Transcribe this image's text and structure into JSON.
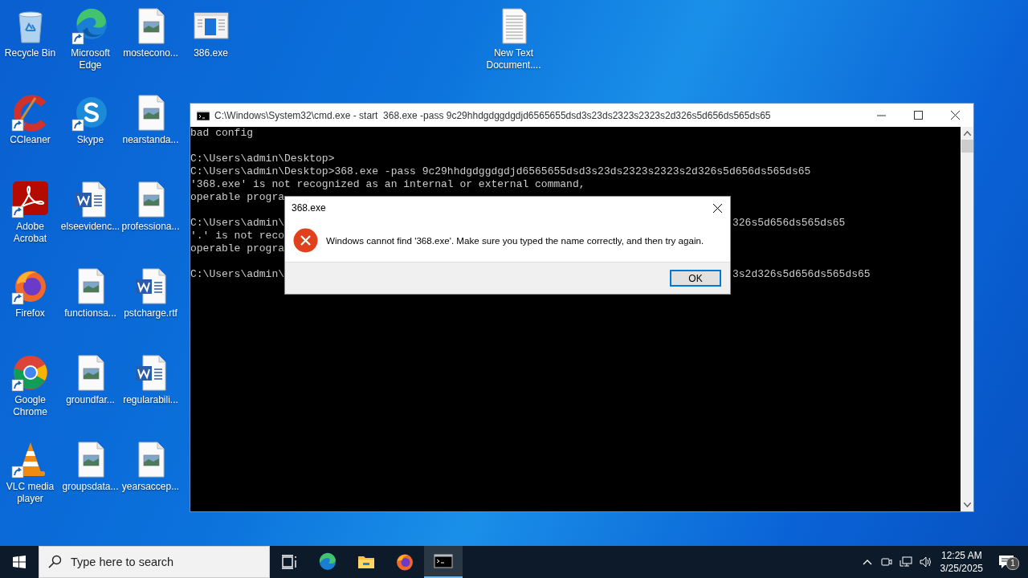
{
  "desktop_columns": [
    [
      {
        "label": "Recycle Bin",
        "kind": "recycle",
        "shortcut": false
      },
      {
        "label": "CCleaner",
        "kind": "ccleaner",
        "shortcut": true
      },
      {
        "label": "Adobe Acrobat",
        "kind": "acrobat",
        "shortcut": true
      },
      {
        "label": "Firefox",
        "kind": "firefox",
        "shortcut": true
      },
      {
        "label": "Google Chrome",
        "kind": "chrome",
        "shortcut": true
      },
      {
        "label": "VLC media player",
        "kind": "vlc",
        "shortcut": true
      }
    ],
    [
      {
        "label": "Microsoft Edge",
        "kind": "edge",
        "shortcut": true
      },
      {
        "label": "Skype",
        "kind": "skype",
        "shortcut": true
      },
      {
        "label": "elseevidenc...",
        "kind": "word",
        "shortcut": false
      },
      {
        "label": "functionsa...",
        "kind": "image",
        "shortcut": false
      },
      {
        "label": "groundfar...",
        "kind": "image",
        "shortcut": false
      },
      {
        "label": "groupsdata...",
        "kind": "image",
        "shortcut": false
      }
    ],
    [
      {
        "label": "mostecono...",
        "kind": "image",
        "shortcut": false
      },
      {
        "label": "nearstanda...",
        "kind": "image",
        "shortcut": false
      },
      {
        "label": "professiona...",
        "kind": "image",
        "shortcut": false
      },
      {
        "label": "pstcharge.rtf",
        "kind": "word",
        "shortcut": false
      },
      {
        "label": "regularabili...",
        "kind": "word",
        "shortcut": false
      },
      {
        "label": "yearsaccep...",
        "kind": "image",
        "shortcut": false
      }
    ],
    [
      {
        "label": "386.exe",
        "kind": "exe",
        "shortcut": false
      }
    ]
  ],
  "far_icon": {
    "label": "New Text Document....",
    "kind": "text",
    "shortcut": false
  },
  "console_window": {
    "title": "C:\\Windows\\System32\\cmd.exe - start  368.exe -pass 9c29hhdgdggdgdjd6565655dsd3s23ds2323s2323s2d326s5d656ds565ds65",
    "lines": [
      {
        "kind": "text",
        "text": "bad config"
      },
      {
        "kind": "blank"
      },
      {
        "kind": "text",
        "text": "C:\\Users\\admin\\Desktop>"
      },
      {
        "kind": "text",
        "text": "C:\\Users\\admin\\Desktop>368.exe -pass 9c29hhdgdggdgdjd6565655dsd3s23ds2323s2323s2d326s5d656ds565ds65"
      },
      {
        "kind": "text",
        "text": "'368.exe' is not recognized as an internal or external command,"
      },
      {
        "kind": "text",
        "text": "operable progra"
      },
      {
        "kind": "blank"
      },
      {
        "kind": "split",
        "text": "C:\\Users\\admin\\",
        "tail": "326s5d656ds565ds65"
      },
      {
        "kind": "text",
        "text": "'.' is not reco"
      },
      {
        "kind": "text",
        "text": "operable progra"
      },
      {
        "kind": "blank"
      },
      {
        "kind": "split",
        "text": "C:\\Users\\admin\\",
        "tail": "3s2d326s5d656ds565ds65"
      }
    ]
  },
  "dialog": {
    "title": "368.exe",
    "message": "Windows cannot find '368.exe'. Make sure you typed the name correctly, and then try again.",
    "button": {
      "label": "OK",
      "default": true
    }
  },
  "taskbar": {
    "search": {
      "placeholder": "Type here to search"
    },
    "apps": [
      {
        "kind": "taskview",
        "active": false
      },
      {
        "kind": "edge",
        "active": false
      },
      {
        "kind": "explorer",
        "active": false
      },
      {
        "kind": "firefox",
        "active": false
      },
      {
        "kind": "terminal",
        "active": true
      }
    ],
    "clock": {
      "time": "12:25 AM",
      "date": "3/25/2025"
    },
    "notifications": {
      "badge": "1"
    }
  }
}
